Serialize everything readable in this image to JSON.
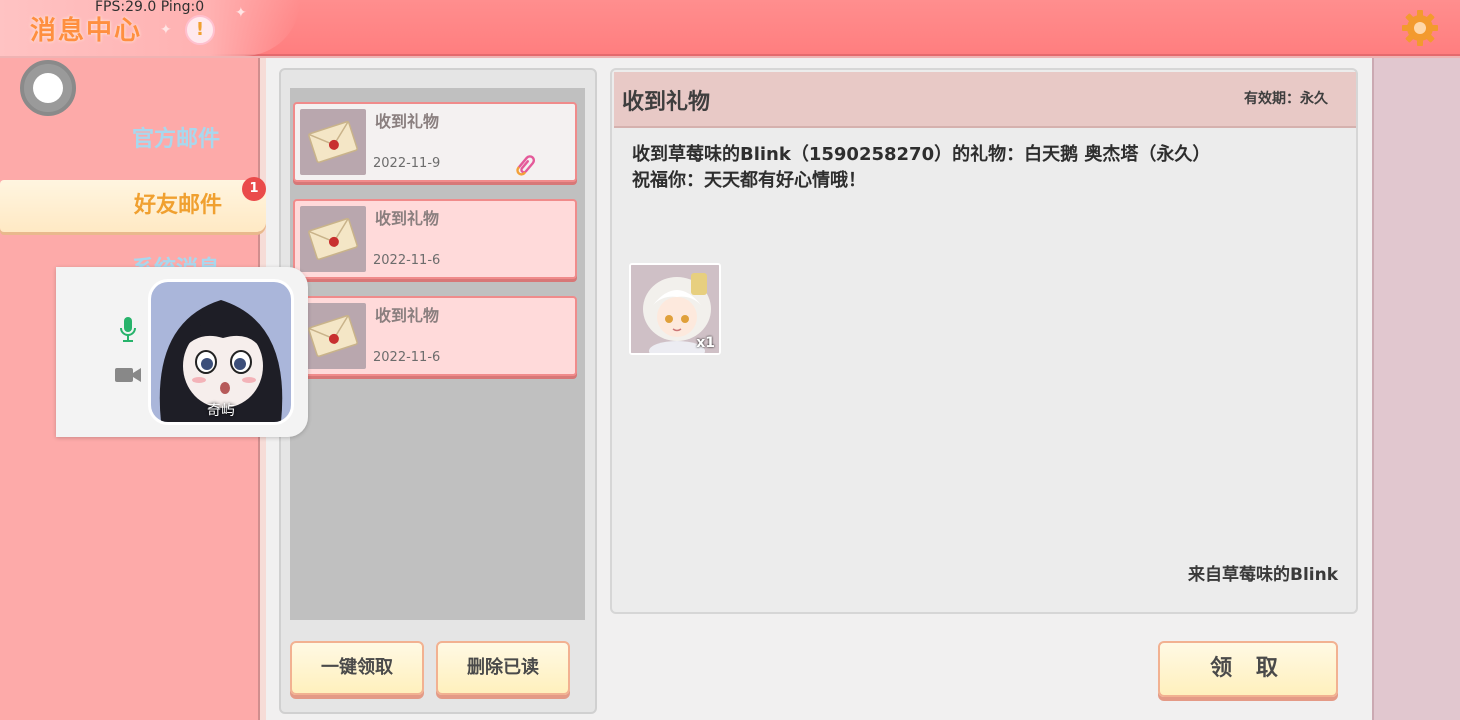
{
  "header": {
    "title": "消息中心",
    "fps_text": "FPS:29.0  Ping:0",
    "alert_symbol": "!",
    "settings_icon": "gear-icon"
  },
  "sidebar": {
    "items": [
      {
        "label": "官方邮件"
      },
      {
        "label": "好友邮件",
        "badge": "1"
      },
      {
        "label": "系统消息"
      }
    ]
  },
  "call_popup": {
    "caller_name": "奇屿",
    "mic_icon": "microphone-icon",
    "camera_icon": "video-camera-icon"
  },
  "mail_list": {
    "items": [
      {
        "title": "收到礼物",
        "date": "2022-11-9",
        "has_attachment": true
      },
      {
        "title": "收到礼物",
        "date": "2022-11-6",
        "has_attachment": false
      },
      {
        "title": "收到礼物",
        "date": "2022-11-6",
        "has_attachment": false
      }
    ],
    "claim_all_label": "一键领取",
    "delete_read_label": "删除已读"
  },
  "detail": {
    "title": "收到礼物",
    "validity": "有效期：永久",
    "body_line1": "收到草莓味的Blink（1590258270）的礼物：白天鹅 奥杰塔（永久）",
    "body_line2": "祝福你：天天都有好心情哦！",
    "gift_qty": "x1",
    "sender": "来自草莓味的Blink",
    "claim_label": "领 取"
  },
  "colors": {
    "header": "#ff8e8e",
    "sidebar": "#fdaaa9",
    "accent_orange": "#f0a030",
    "card_border": "#f08b8b"
  }
}
